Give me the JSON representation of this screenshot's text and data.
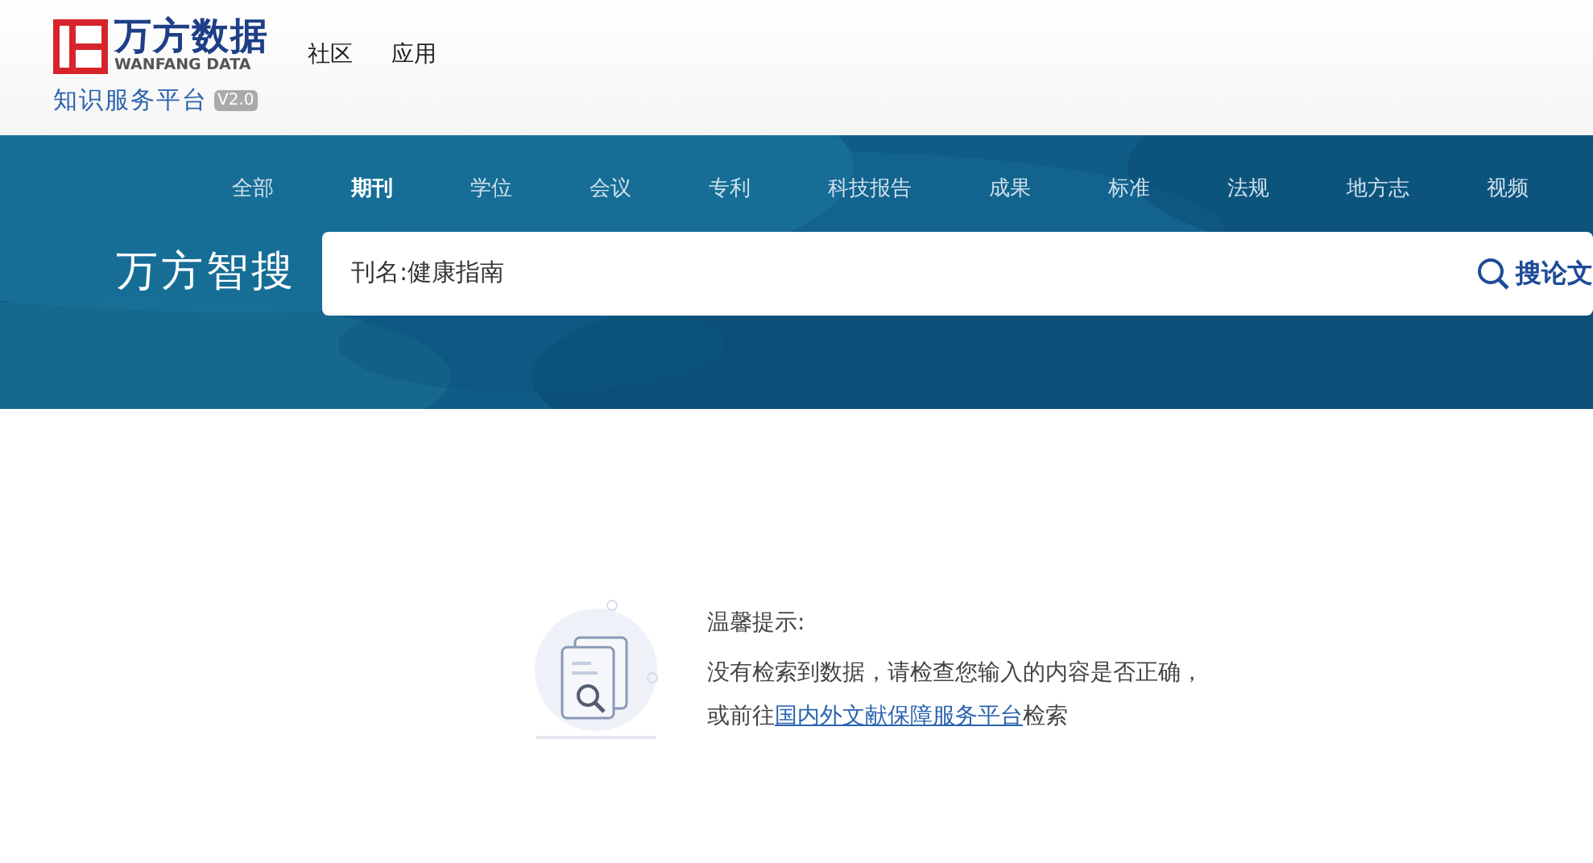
{
  "logo": {
    "name": "万方数据",
    "english": "WANFANG DATA",
    "subtitle": "知识服务平台",
    "version": "V2.0"
  },
  "top_nav": [
    {
      "label": "社区"
    },
    {
      "label": "应用"
    }
  ],
  "banner": {
    "brand": "万方智搜",
    "tabs": [
      {
        "label": "全部",
        "selected": false
      },
      {
        "label": "期刊",
        "selected": true
      },
      {
        "label": "学位",
        "selected": false
      },
      {
        "label": "会议",
        "selected": false
      },
      {
        "label": "专利",
        "selected": false
      },
      {
        "label": "科技报告",
        "selected": false
      },
      {
        "label": "成果",
        "selected": false
      },
      {
        "label": "标准",
        "selected": false
      },
      {
        "label": "法规",
        "selected": false
      },
      {
        "label": "地方志",
        "selected": false
      },
      {
        "label": "视频",
        "selected": false
      }
    ],
    "search": {
      "value": "刊名:健康指南",
      "button": "搜论文"
    }
  },
  "notice": {
    "title": "温馨提示:",
    "line_1": "没有检索到数据，请检查您输入的内容是否正确，",
    "line_2_before": "或前往",
    "line_2_link": "国内外文献保障服务平台",
    "line_2_after": "检索"
  }
}
